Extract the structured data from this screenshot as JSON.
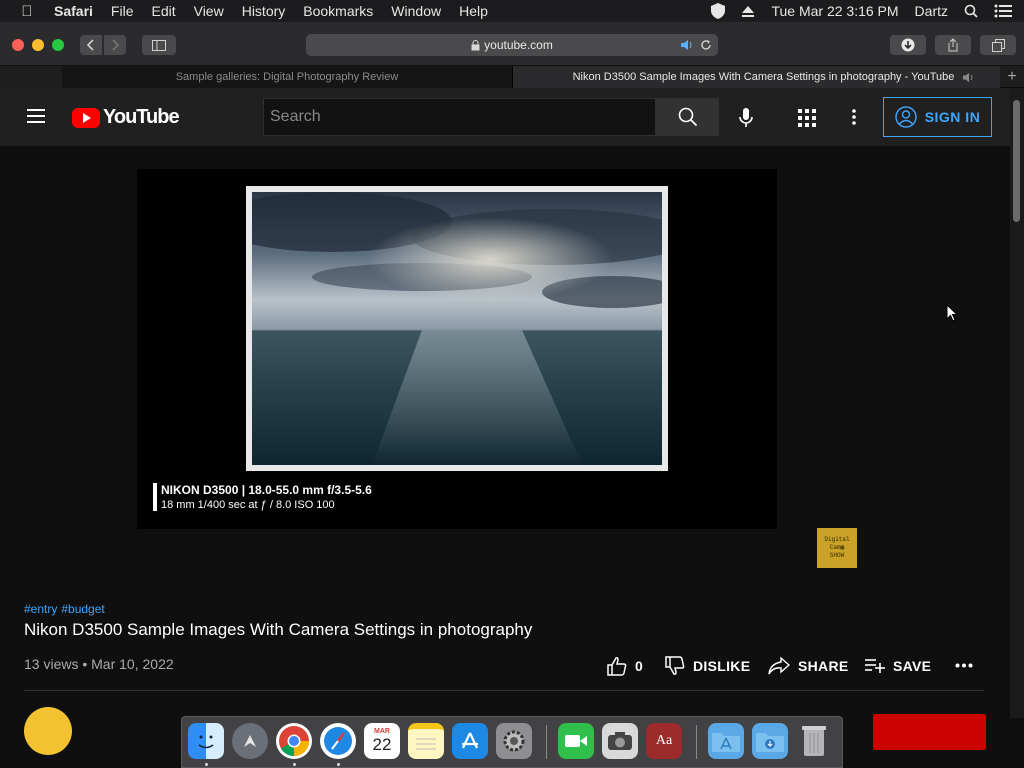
{
  "menubar": {
    "app": "Safari",
    "items": [
      "File",
      "Edit",
      "View",
      "History",
      "Bookmarks",
      "Window",
      "Help"
    ],
    "datetime": "Tue Mar 22  3:16 PM",
    "user": "Dartz"
  },
  "browser": {
    "url": "youtube.com",
    "tabs": [
      {
        "title": "Sample galleries: Digital Photography Review",
        "active": false
      },
      {
        "title": "Nikon D3500 Sample Images With Camera Settings in photography - YouTube",
        "active": true
      }
    ]
  },
  "youtube": {
    "logo_text": "YouTube",
    "search_placeholder": "Search",
    "sign_in": "SIGN IN"
  },
  "video": {
    "caption_line1": "NIKON D3500 | 18.0-55.0 mm f/3.5-5.6",
    "caption_line2": "18 mm 1/400 sec at ƒ / 8.0 ISO 100",
    "watermark": [
      "Digital",
      "Cam",
      "SHOW"
    ],
    "hashtags": [
      "#entry",
      "#budget"
    ],
    "title": "Nikon D3500 Sample Images With Camera Settings in photography",
    "views_date": "13 views • Mar 10, 2022",
    "like_count": "0",
    "dislike_label": "DISLIKE",
    "share_label": "SHARE",
    "save_label": "SAVE"
  },
  "dock": {
    "calendar_month": "MAR",
    "calendar_day": "22",
    "dictionary_glyph": "Aa"
  },
  "colors": {
    "accent": "#3ea6ff",
    "youtube_red": "#ff0000",
    "background": "#0f0f0f"
  }
}
